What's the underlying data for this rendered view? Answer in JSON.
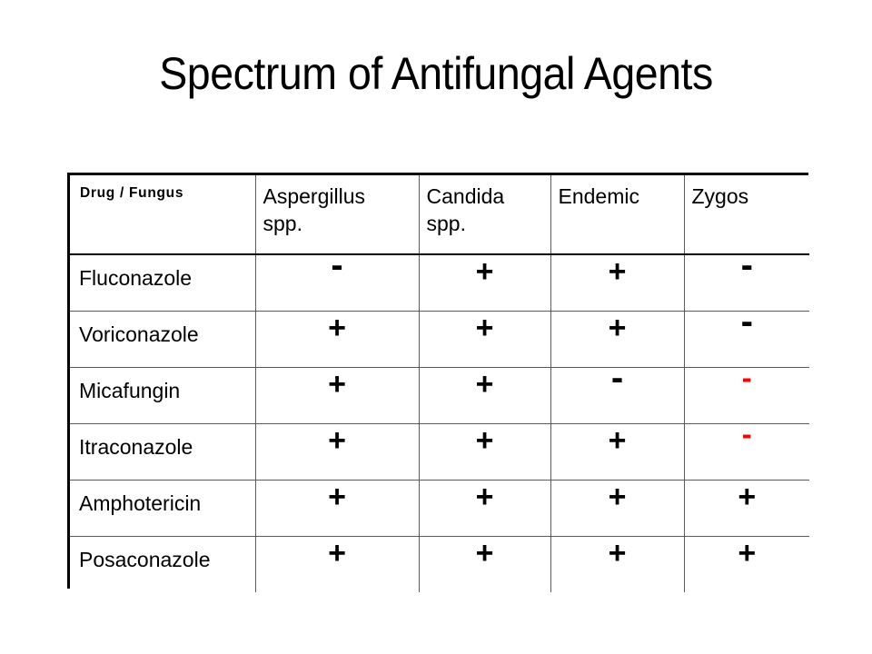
{
  "slide": {
    "title": "Spectrum of Antifungal Agents",
    "background_color": "#ffffff"
  },
  "colors": {
    "text": "#000000",
    "highlight": "#ff0000",
    "outer_border": "#000000",
    "inner_border": "#5a5a5a"
  },
  "table": {
    "name": "antifungal-spectrum-table",
    "columns": [
      {
        "id": "drug",
        "label": "Drug / Fungus",
        "label_line2": ""
      },
      {
        "id": "aspergillus",
        "label": "Aspergillus",
        "label_line2": "spp."
      },
      {
        "id": "candida",
        "label": "Candida",
        "label_line2": "spp."
      },
      {
        "id": "endemic",
        "label": "Endemic",
        "label_line2": ""
      },
      {
        "id": "zygos",
        "label": "Zygos",
        "label_line2": ""
      }
    ],
    "rows": [
      {
        "drug": "Fluconazole",
        "cells": [
          {
            "symbol": "-",
            "color": "#000000"
          },
          {
            "symbol": "+",
            "color": "#000000"
          },
          {
            "symbol": "+",
            "color": "#000000"
          },
          {
            "symbol": "-",
            "color": "#000000"
          }
        ]
      },
      {
        "drug": "Voriconazole",
        "cells": [
          {
            "symbol": "+",
            "color": "#000000"
          },
          {
            "symbol": "+",
            "color": "#000000"
          },
          {
            "symbol": "+",
            "color": "#000000"
          },
          {
            "symbol": "-",
            "color": "#000000"
          }
        ]
      },
      {
        "drug": "Micafungin",
        "cells": [
          {
            "symbol": "+",
            "color": "#000000"
          },
          {
            "symbol": "+",
            "color": "#000000"
          },
          {
            "symbol": "-",
            "color": "#000000"
          },
          {
            "symbol": "-",
            "color": "#ff0000"
          }
        ]
      },
      {
        "drug": "Itraconazole",
        "cells": [
          {
            "symbol": "+",
            "color": "#000000"
          },
          {
            "symbol": "+",
            "color": "#000000"
          },
          {
            "symbol": "+",
            "color": "#000000"
          },
          {
            "symbol": "-",
            "color": "#ff0000"
          }
        ]
      },
      {
        "drug": "Amphotericin",
        "cells": [
          {
            "symbol": "+",
            "color": "#000000"
          },
          {
            "symbol": "+",
            "color": "#000000"
          },
          {
            "symbol": "+",
            "color": "#000000"
          },
          {
            "symbol": "+",
            "color": "#000000"
          }
        ]
      },
      {
        "drug": "Posaconazole",
        "cells": [
          {
            "symbol": "+",
            "color": "#000000"
          },
          {
            "symbol": "+",
            "color": "#000000"
          },
          {
            "symbol": "+",
            "color": "#000000"
          },
          {
            "symbol": "+",
            "color": "#000000"
          }
        ]
      }
    ]
  }
}
